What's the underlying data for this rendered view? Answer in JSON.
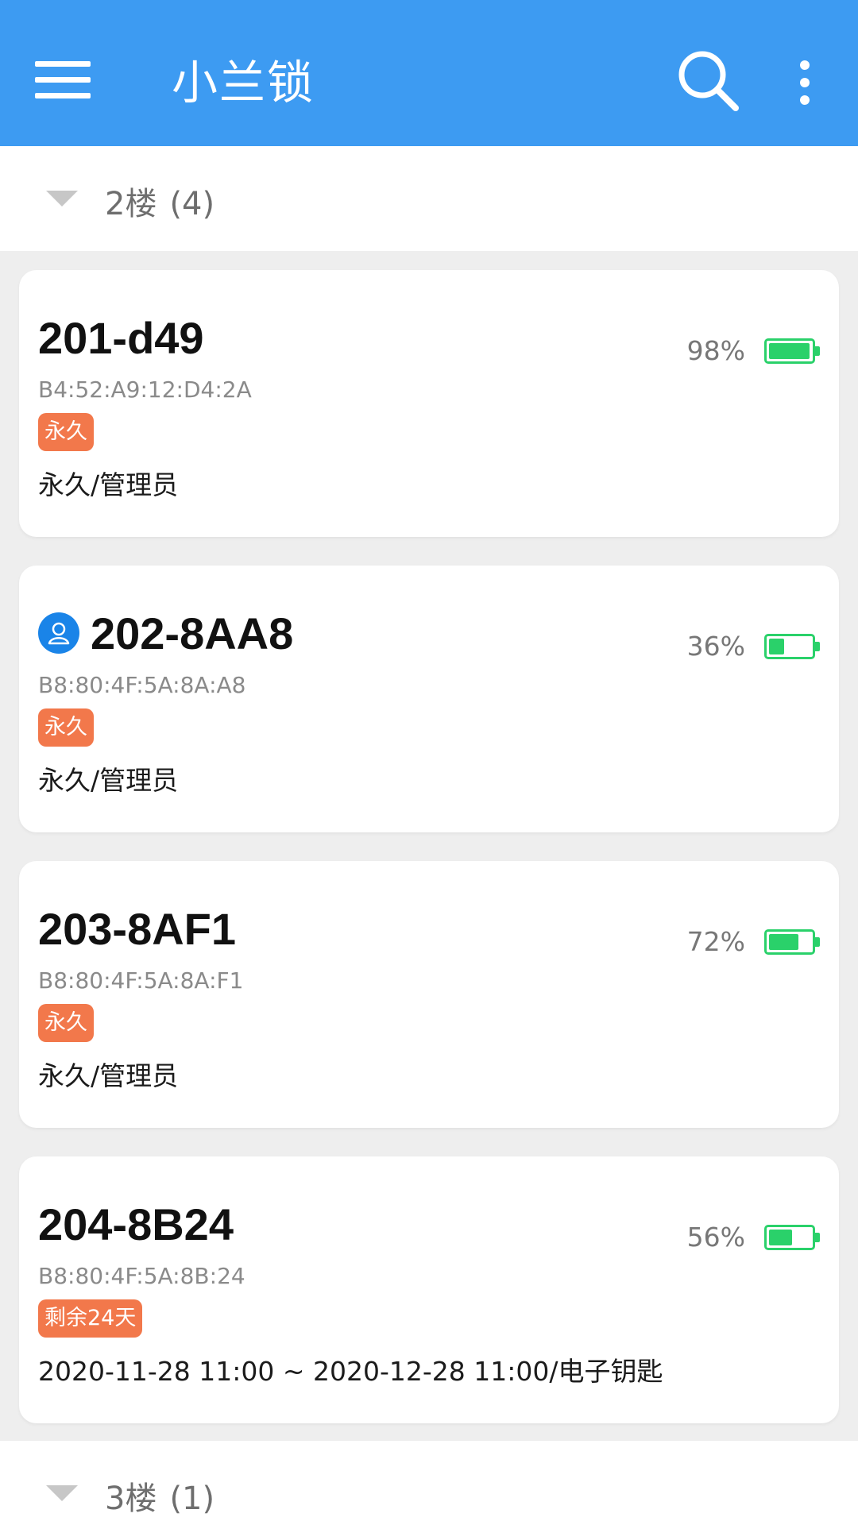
{
  "app": {
    "title": "小兰锁",
    "accent_color": "#3d9bf2",
    "icons": {
      "menu": "hamburger-menu-icon",
      "search": "search-icon",
      "more": "more-vert-icon"
    }
  },
  "groups": [
    {
      "floor": "2楼",
      "count": "(4)",
      "expanded": true
    },
    {
      "floor": "3楼",
      "count": "(1)",
      "expanded": true
    }
  ],
  "locks": [
    {
      "name": "201-d49",
      "mac": "B4:52:A9:12:D4:2A",
      "badge": "永久",
      "desc": "永久/管理员",
      "battery_text": "98%",
      "battery_level": 0.98,
      "user_icon": false
    },
    {
      "name": "202-8AA8",
      "mac": "B8:80:4F:5A:8A:A8",
      "badge": "永久",
      "desc": "永久/管理员",
      "battery_text": "36%",
      "battery_level": 0.36,
      "user_icon": true
    },
    {
      "name": "203-8AF1",
      "mac": "B8:80:4F:5A:8A:F1",
      "badge": "永久",
      "desc": "永久/管理员",
      "battery_text": "72%",
      "battery_level": 0.72,
      "user_icon": false
    },
    {
      "name": "204-8B24",
      "mac": "B8:80:4F:5A:8B:24",
      "badge": "剩余24天",
      "desc": "2020-11-28 11:00 ~ 2020-12-28 11:00/电子钥匙",
      "battery_text": "56%",
      "battery_level": 0.56,
      "user_icon": false
    }
  ],
  "colors": {
    "badge": "#f2784b",
    "battery": "#2ad16a",
    "user_icon": "#1a84e8"
  }
}
